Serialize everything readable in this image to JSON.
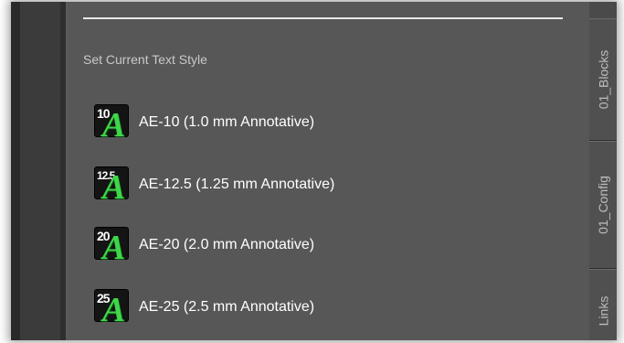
{
  "panel": {
    "section_title": "Set Current Text Style",
    "items": [
      {
        "badge": "10",
        "icon_letter": "A",
        "label": "AE-10 (1.0 mm Annotative)"
      },
      {
        "badge": "12.5",
        "icon_letter": "A",
        "label": "AE-12.5 (1.25 mm Annotative)"
      },
      {
        "badge": "20",
        "icon_letter": "A",
        "label": "AE-20 (2.0 mm Annotative)"
      },
      {
        "badge": "25",
        "icon_letter": "A",
        "label": "AE-25 (2.5 mm Annotative)"
      }
    ]
  },
  "tabs": [
    {
      "label": "01_Blocks"
    },
    {
      "label": "01_Config"
    },
    {
      "label": "Links"
    }
  ],
  "colors": {
    "panel_bg": "#575757",
    "icon_letter": "#3fd64a",
    "icon_tile": "#141414"
  }
}
